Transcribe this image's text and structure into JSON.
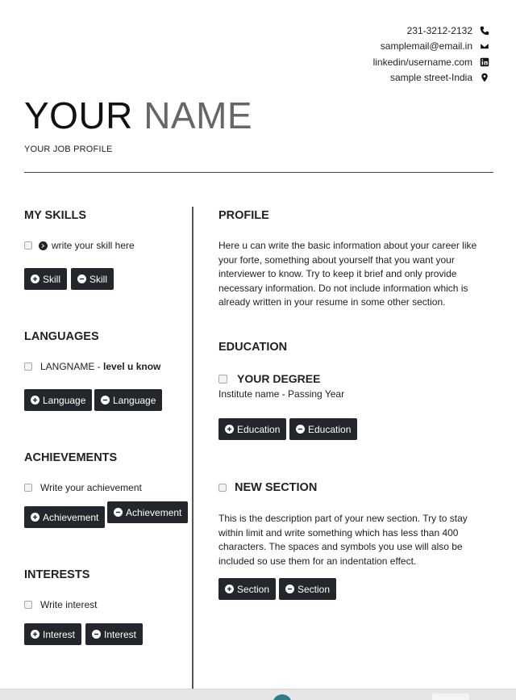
{
  "contact": {
    "phone": "231-3212-2132",
    "email": "samplemail@email.in",
    "linkedin": "linkedin/username.com",
    "address": "sample street-India"
  },
  "header": {
    "first_name": "YOUR",
    "last_name": "NAME",
    "job_profile": "YOUR JOB PROFILE"
  },
  "skills": {
    "title": "MY SKILLS",
    "item": "write your skill here",
    "add_label": "Skill",
    "remove_label": "Skill"
  },
  "languages": {
    "title": "LANGUAGES",
    "item_name": "LANGNAME - ",
    "item_level": "level u know",
    "add_label": "Language",
    "remove_label": "Language"
  },
  "achievements": {
    "title": "ACHIEVEMENTS",
    "item": "Write your achievement",
    "add_label": "Achievement",
    "remove_label": "Achievement"
  },
  "interests": {
    "title": "INTERESTS",
    "item": "Write interest",
    "add_label": "Interest",
    "remove_label": "Interest"
  },
  "profile": {
    "title": "PROFILE",
    "text": "Here u can write the basic information about your career like your forte, something about yourself that you want your interviewer to know. Try to keep it brief and only provide necessary information. Do not include information which is already written in your resume in some other section."
  },
  "education": {
    "title": "EDUCATION",
    "degree": "YOUR DEGREE",
    "institute": "Institute name - Passing Year",
    "add_label": "Education",
    "remove_label": "Education"
  },
  "new_section": {
    "title": "NEW SECTION",
    "text": "This is the description part of your new section. Try to stay within limit and write something which has less than 400 characters. The spaces and symbols you use will also be included so use them for an indentation effect.",
    "add_label": "Section",
    "remove_label": "Section"
  }
}
